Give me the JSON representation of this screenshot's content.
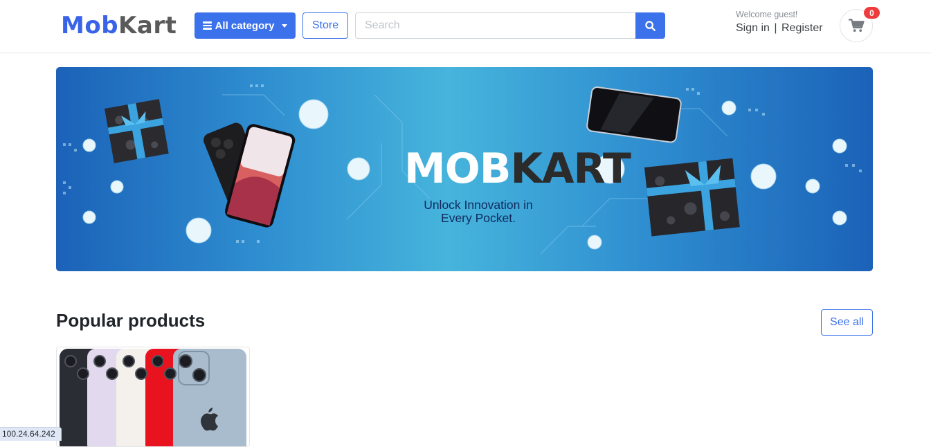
{
  "header": {
    "logo": {
      "part1": "Mob",
      "part2": "Kart"
    },
    "category_button": "All category",
    "store_button": "Store",
    "search": {
      "placeholder": "Search",
      "value": ""
    },
    "welcome_text": "Welcome guest!",
    "sign_in": "Sign in",
    "separator": "|",
    "register": "Register",
    "cart_count": "0"
  },
  "banner": {
    "title_part1": "MOB",
    "title_part2": "KART",
    "tagline_line1": "Unlock Innovation in",
    "tagline_line2": "Every Pocket."
  },
  "popular": {
    "title": "Popular products",
    "see_all": "See all"
  },
  "status_bar": {
    "ip": "100.24.64.242"
  },
  "colors": {
    "primary": "#3b71ea",
    "logo_blue": "#3a64e8",
    "logo_gray": "#5a5a5a",
    "badge_red": "#ee3b3b"
  },
  "icons": [
    "bars-icon",
    "caret-down-icon",
    "search-icon",
    "shopping-cart-icon"
  ]
}
